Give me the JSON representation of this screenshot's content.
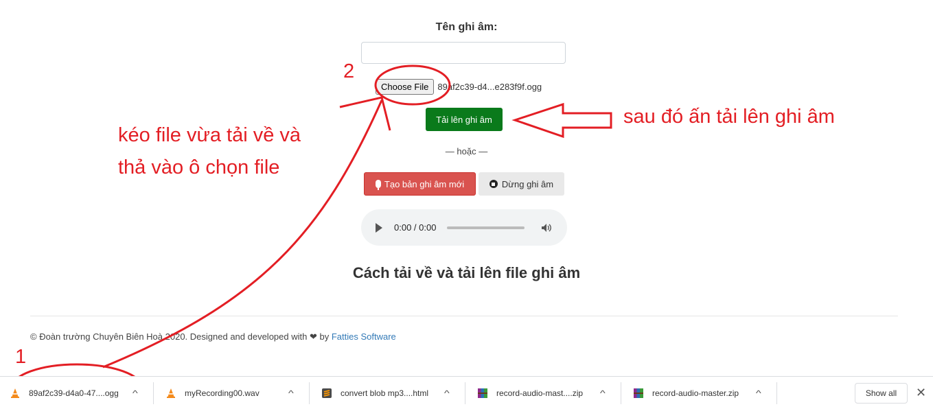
{
  "form": {
    "name_label": "Tên ghi âm:",
    "name_value": "",
    "choose_file_label": "Choose File",
    "chosen_file": "89af2c39-d4...e283f9f.ogg",
    "upload_label": "Tải lên ghi âm",
    "or_label": "— hoặc —",
    "record_label": "Tạo bản ghi âm mới",
    "stop_label": "Dừng ghi âm"
  },
  "audio": {
    "time": "0:00 / 0:00",
    "icons": [
      "play-icon",
      "volume-icon"
    ]
  },
  "section": {
    "heading": "Cách tải về và tải lên file ghi âm"
  },
  "footer": {
    "text": "© Đoàn trường Chuyên Biên Hoà 2020. Designed and developed with",
    "by": "by",
    "link": "Fatties Software"
  },
  "annotations": {
    "drag_line1": "kéo file vừa tải về và",
    "drag_line2": "thả vào ô chọn file",
    "then_upload": "sau đó ấn tải lên ghi âm",
    "step1": "1",
    "step2": "2",
    "color": "#e31e24"
  },
  "downloads": {
    "items": [
      {
        "name": "89af2c39-d4a0-47....ogg",
        "icon": "vlc-icon"
      },
      {
        "name": "myRecording00.wav",
        "icon": "vlc-icon"
      },
      {
        "name": "convert blob mp3....html",
        "icon": "sublime-icon"
      },
      {
        "name": "record-audio-mast....zip",
        "icon": "winrar-icon"
      },
      {
        "name": "record-audio-master.zip",
        "icon": "winrar-icon"
      }
    ],
    "show_all": "Show all"
  },
  "colors": {
    "upload_button": "#0a7a1b",
    "record_button": "#d9534f",
    "link": "#337ab7"
  }
}
